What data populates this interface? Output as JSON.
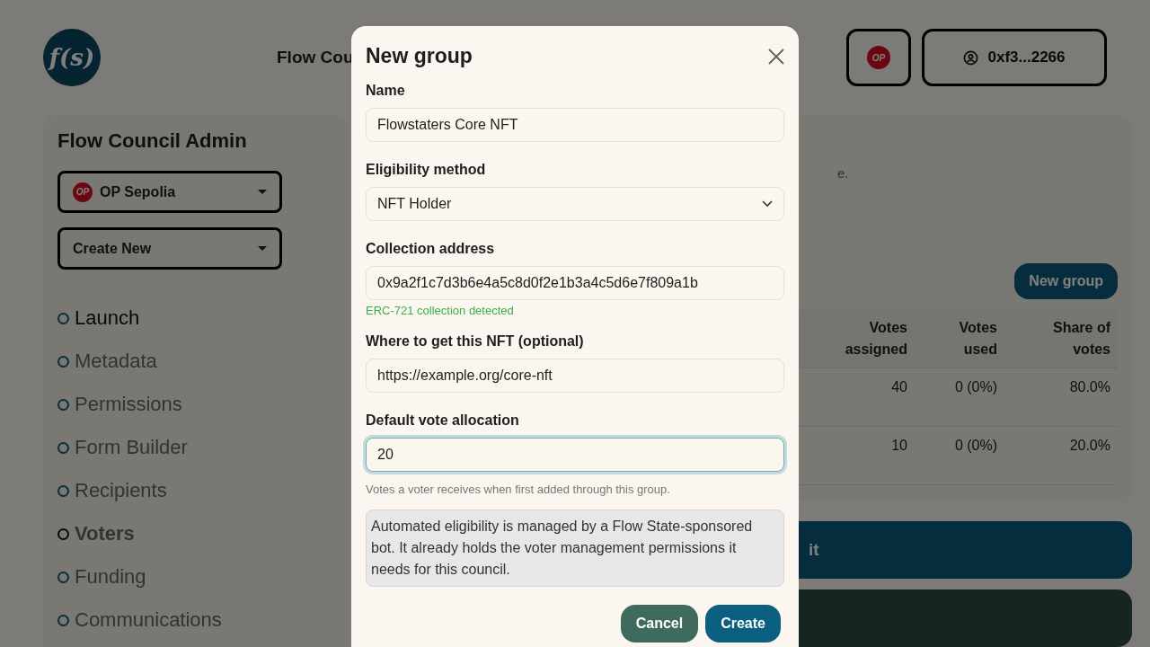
{
  "header": {
    "logo": "f(s)",
    "nav_title": "Flow Cou",
    "network_badge": "OP",
    "wallet": "0xf3...2266"
  },
  "sidebar": {
    "title": "Flow Council Admin",
    "network_select": {
      "badge": "OP",
      "value": "OP Sepolia"
    },
    "create_select": {
      "value": "Create New"
    },
    "items": [
      {
        "label": "Launch",
        "selected": false,
        "dim": false
      },
      {
        "label": "Metadata",
        "selected": false,
        "dim": true
      },
      {
        "label": "Permissions",
        "selected": false,
        "dim": true
      },
      {
        "label": "Form Builder",
        "selected": false,
        "dim": true
      },
      {
        "label": "Recipients",
        "selected": false,
        "dim": true
      },
      {
        "label": "Voters",
        "selected": true,
        "dim": true
      },
      {
        "label": "Funding",
        "selected": false,
        "dim": true
      },
      {
        "label": "Communications",
        "selected": false,
        "dim": true
      }
    ]
  },
  "content": {
    "description_tail": "e.",
    "new_group_button": "New group",
    "table": {
      "columns": [
        "Votes assigned",
        "Votes used",
        "Share of votes"
      ],
      "rows": [
        [
          "40",
          "0 (0%)",
          "80.0%"
        ],
        [
          "10",
          "0 (0%)",
          "20.0%"
        ]
      ]
    },
    "primary_bar": "it"
  },
  "dialog": {
    "title": "New group",
    "fields": [
      {
        "kind": "text",
        "label": "Name",
        "value": "Flowstaters Core NFT",
        "focused": false
      },
      {
        "kind": "select",
        "label": "Eligibility method",
        "value": "NFT Holder",
        "focused": false
      },
      {
        "kind": "text",
        "label": "Collection address",
        "value": "0x9a2f1c7d3b6e4a5c8d0f2e1b3a4c5d6e7f809a1b",
        "focused": false,
        "success": "ERC-721 collection detected"
      },
      {
        "kind": "text",
        "label": "Where to get this NFT (optional)",
        "value": "https://example.org/core-nft",
        "focused": false
      },
      {
        "kind": "text",
        "label": "Default vote allocation",
        "value": "20",
        "focused": true,
        "hint": "Votes a voter receives when first added through this group."
      }
    ],
    "notice": "Automated eligibility is managed by a Flow State-sponsored bot. It already holds the voter management permissions it needs for this council.",
    "buttons": [
      {
        "kind": "secondary",
        "label": "Cancel"
      },
      {
        "kind": "primary",
        "label": "Create"
      }
    ]
  }
}
